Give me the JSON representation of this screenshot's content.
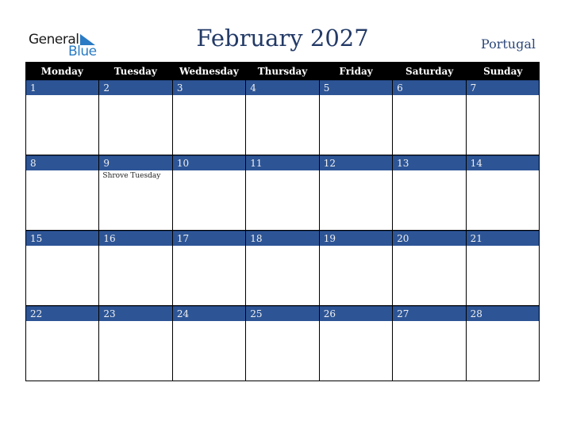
{
  "logo": {
    "line1": "General",
    "line2": "Blue",
    "accent_color": "#2a7bc4"
  },
  "header": {
    "title": "February 2027",
    "country": "Portugal"
  },
  "colors": {
    "title": "#233a66",
    "day_bar": "#2d5596",
    "header_bg": "#000000"
  },
  "weekdays": [
    "Monday",
    "Tuesday",
    "Wednesday",
    "Thursday",
    "Friday",
    "Saturday",
    "Sunday"
  ],
  "weeks": [
    [
      {
        "day": "1",
        "event": ""
      },
      {
        "day": "2",
        "event": ""
      },
      {
        "day": "3",
        "event": ""
      },
      {
        "day": "4",
        "event": ""
      },
      {
        "day": "5",
        "event": ""
      },
      {
        "day": "6",
        "event": ""
      },
      {
        "day": "7",
        "event": ""
      }
    ],
    [
      {
        "day": "8",
        "event": ""
      },
      {
        "day": "9",
        "event": "Shrove Tuesday"
      },
      {
        "day": "10",
        "event": ""
      },
      {
        "day": "11",
        "event": ""
      },
      {
        "day": "12",
        "event": ""
      },
      {
        "day": "13",
        "event": ""
      },
      {
        "day": "14",
        "event": ""
      }
    ],
    [
      {
        "day": "15",
        "event": ""
      },
      {
        "day": "16",
        "event": ""
      },
      {
        "day": "17",
        "event": ""
      },
      {
        "day": "18",
        "event": ""
      },
      {
        "day": "19",
        "event": ""
      },
      {
        "day": "20",
        "event": ""
      },
      {
        "day": "21",
        "event": ""
      }
    ],
    [
      {
        "day": "22",
        "event": ""
      },
      {
        "day": "23",
        "event": ""
      },
      {
        "day": "24",
        "event": ""
      },
      {
        "day": "25",
        "event": ""
      },
      {
        "day": "26",
        "event": ""
      },
      {
        "day": "27",
        "event": ""
      },
      {
        "day": "28",
        "event": ""
      }
    ]
  ]
}
